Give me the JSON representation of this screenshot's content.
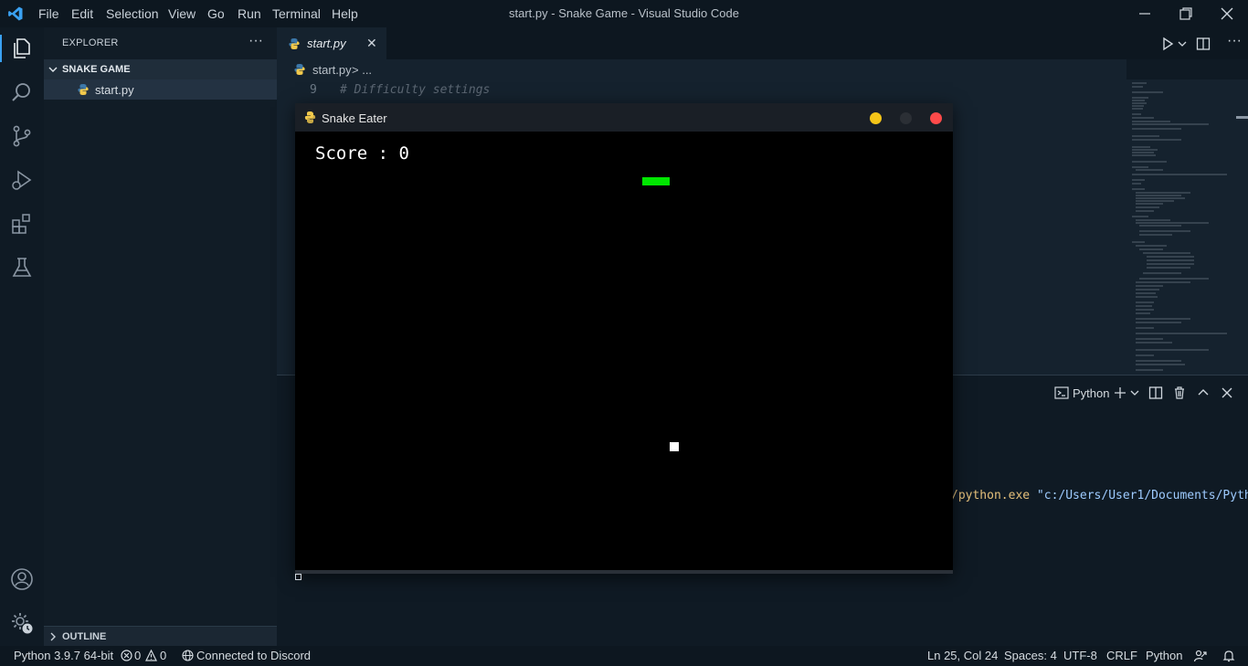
{
  "titlebar": {
    "menu": [
      "File",
      "Edit",
      "Selection",
      "View",
      "Go",
      "Run",
      "Terminal",
      "Help"
    ],
    "window_title": "start.py - Snake Game - Visual Studio Code"
  },
  "sidebar": {
    "title": "EXPLORER",
    "more": "···",
    "folder": "SNAKE GAME",
    "file": "start.py",
    "outline": "OUTLINE"
  },
  "editor": {
    "tab_label": "start.py",
    "tab_close": "✕",
    "breadcrumb_file": "start.py",
    "breadcrumb_rest": "> ...",
    "line_number": "9",
    "code_comment": "# Difficulty settings"
  },
  "panel": {
    "terminal_name": "Python",
    "output_exe": "/python.exe ",
    "output_path": "\"c:/Users/User1/Documents/Python"
  },
  "game": {
    "window_title": "Snake Eater",
    "score_label": "Score : 0",
    "colors": {
      "snake": "#00e600",
      "food": "#ffffff",
      "background": "#000000"
    }
  },
  "statusbar": {
    "python": "Python 3.9.7 64-bit",
    "errors": "0",
    "warnings": "0",
    "discord": "Connected to Discord",
    "position": "Ln 25, Col 24",
    "spaces": "Spaces: 4",
    "encoding": "UTF-8",
    "eol": "CRLF",
    "language": "Python"
  },
  "icons": [
    "vscode-logo-icon",
    "files-icon",
    "search-icon",
    "source-control-icon",
    "run-debug-icon",
    "extensions-icon",
    "testing-icon",
    "account-icon",
    "manage-gear-icon",
    "python-file-icon",
    "pygame-icon"
  ],
  "accent_colors": {
    "vscode_blue": "#3aa1f2",
    "minimize_yellow": "#f5c518",
    "close_red": "#ff4a4a"
  }
}
